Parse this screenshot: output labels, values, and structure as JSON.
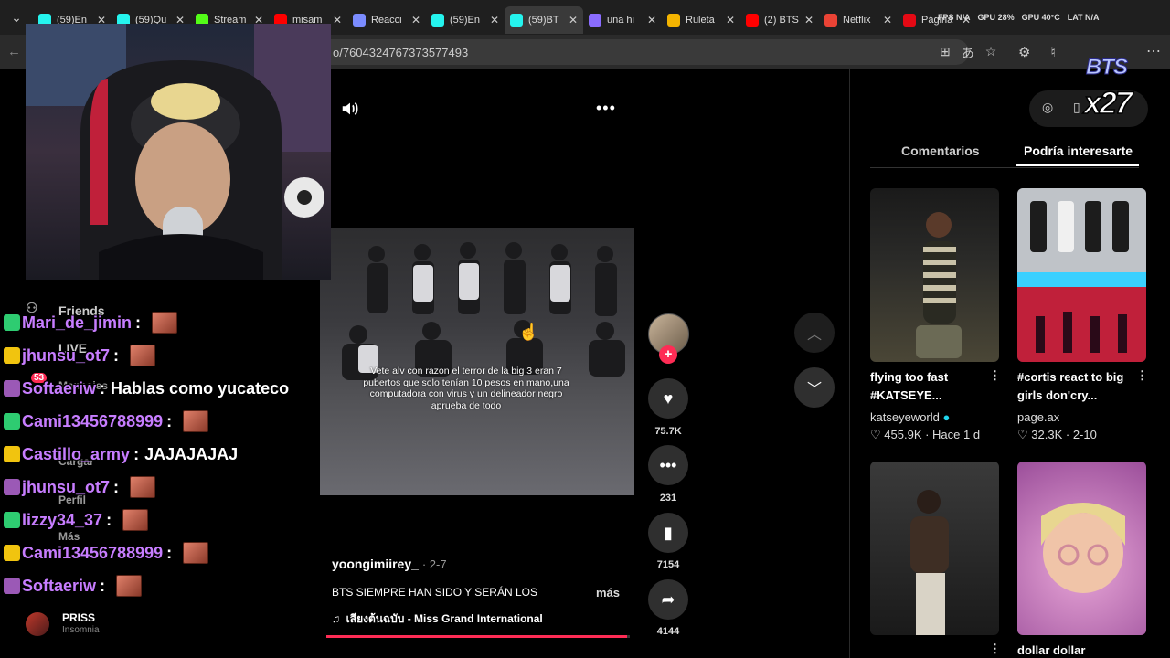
{
  "browser": {
    "tabs": [
      {
        "label": "(59)En",
        "icon": "tiktok-icon",
        "color": "#25f4ee"
      },
      {
        "label": "(59)Qu",
        "icon": "tiktok-icon",
        "color": "#25f4ee"
      },
      {
        "label": "Stream",
        "icon": "kick-icon",
        "color": "#53fc18"
      },
      {
        "label": "misam",
        "icon": "youtube-icon",
        "color": "#ff0000"
      },
      {
        "label": "Reacci",
        "icon": "docs-icon",
        "color": "#7b8cff"
      },
      {
        "label": "(59)En",
        "icon": "tiktok-icon",
        "color": "#25f4ee"
      },
      {
        "label": "(59)BT",
        "icon": "tiktok-icon",
        "color": "#25f4ee"
      },
      {
        "label": "una hi",
        "icon": "chat-icon",
        "color": "#8a6cff"
      },
      {
        "label": "Ruleta",
        "icon": "wheel-icon",
        "color": "#f4b400"
      },
      {
        "label": "(2) BTS",
        "icon": "youtube-icon",
        "color": "#ff0000"
      },
      {
        "label": "Netflix",
        "icon": "gmail-icon",
        "color": "#ea4335"
      },
      {
        "label": "Página",
        "icon": "netflix-icon",
        "color": "#e50914"
      }
    ],
    "active_tab_index": 6,
    "url": "o/7604324767373577493"
  },
  "hud": {
    "fps": "FPS",
    "fps_value": "N/A",
    "gpu_label": "GPU",
    "gpu_value": "28%",
    "gpu2": "GPU 40°C",
    "lat": "LAT",
    "lat_value": "N/A"
  },
  "overlay_badge": {
    "line1": "BTS",
    "line2": "x27"
  },
  "video": {
    "caption": "Vete alv con razon el terror de la big 3 eran 7 pubertos que solo tenían 10 pesos en mano,una computadora con virus y un delineador negro aprueba de todo",
    "likes": "75.7K",
    "comments": "231",
    "saves": "7154",
    "shares": "4144",
    "author": "yoongimiirey_",
    "post_date": "· 2-7",
    "description": "BTS SIEMPRE HAN SIDO Y SERÁN LOS",
    "more": "más",
    "music": "เสียงต้นฉบับ - Miss Grand International",
    "progress": 0.99
  },
  "right_panel": {
    "tab_comments": "Comentarios",
    "tab_recommended": "Podría interesarte",
    "cards": [
      {
        "title": "flying too fast #KATSEYE...",
        "author": "katseyeworld",
        "likes": "455.9K",
        "date": "Hace 1 d"
      },
      {
        "title": "#cortis react to big girls don'cry...",
        "author": "page.ax",
        "likes": "32.3K",
        "date": "2-10"
      },
      {
        "title": "",
        "author": "",
        "likes": "",
        "date": ""
      },
      {
        "title": "dollar dollar",
        "author": "",
        "likes": "",
        "date": ""
      }
    ]
  },
  "sidebar_ghost": {
    "friends": "Friends",
    "live": "LIVE",
    "mensajes": "Mensajes",
    "badge": "53",
    "cargar": "Cargar",
    "perfil": "Perfil",
    "mas": "Más"
  },
  "chat": [
    {
      "user": "Mari_de_jimin",
      "color": "#c77dff",
      "sep": ":",
      "message": ""
    },
    {
      "user": "jhunsu_ot7",
      "color": "#c77dff",
      "sep": ":",
      "message": ""
    },
    {
      "user": "Softaeriw",
      "color": "#c77dff",
      "sep": ":",
      "message": "Hablas como yucateco"
    },
    {
      "user": "Cami13456788999",
      "color": "#c77dff",
      "sep": ":",
      "message": ""
    },
    {
      "user": "Castillo_army",
      "color": "#c77dff",
      "sep": ":",
      "message": "JAJAJAJAJ"
    },
    {
      "user": "jhunsu_ot7",
      "color": "#c77dff",
      "sep": ":",
      "message": ""
    },
    {
      "user": "lizzy34_37",
      "color": "#c77dff",
      "sep": ":",
      "message": ""
    },
    {
      "user": "Cami13456788999",
      "color": "#c77dff",
      "sep": ":",
      "message": ""
    },
    {
      "user": "Softaeriw",
      "color": "#c77dff",
      "sep": ":",
      "message": ""
    }
  ],
  "friend": {
    "name": "PRISS",
    "status": "Insomnia"
  }
}
